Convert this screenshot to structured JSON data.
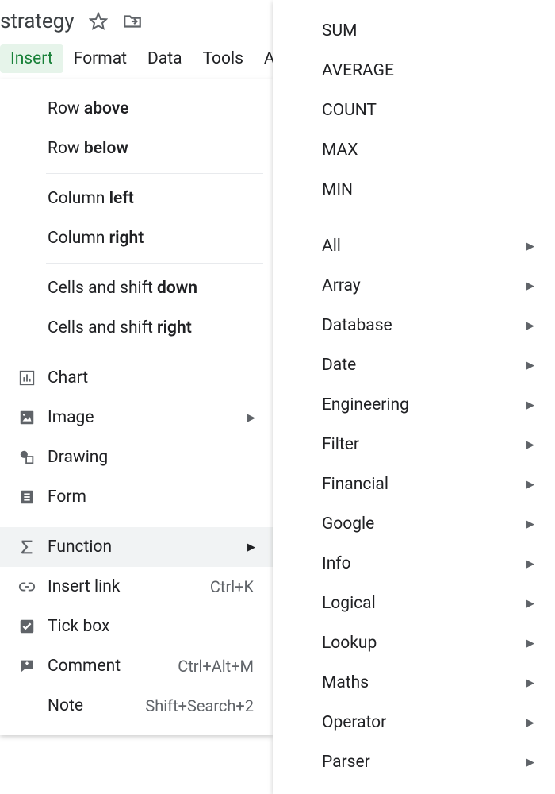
{
  "doc_title_fragment": "strategy",
  "menubar": {
    "insert": "Insert",
    "format": "Format",
    "data": "Data",
    "tools": "Tools",
    "next_letter": "A"
  },
  "insert_menu": {
    "row_above_prefix": "Row ",
    "row_above_bold": "above",
    "row_below_prefix": "Row ",
    "row_below_bold": "below",
    "col_left_prefix": "Column ",
    "col_left_bold": "left",
    "col_right_prefix": "Column ",
    "col_right_bold": "right",
    "cells_down_prefix": "Cells and shift ",
    "cells_down_bold": "down",
    "cells_right_prefix": "Cells and shift ",
    "cells_right_bold": "right",
    "chart": "Chart",
    "image": "Image",
    "drawing": "Drawing",
    "form": "Form",
    "function": "Function",
    "insert_link": "Insert link",
    "insert_link_shortcut": "Ctrl+K",
    "tick_box": "Tick box",
    "comment": "Comment",
    "comment_shortcut": "Ctrl+Alt+M",
    "note": "Note",
    "note_shortcut": "Shift+Search+2"
  },
  "function_submenu": {
    "common": [
      "SUM",
      "AVERAGE",
      "COUNT",
      "MAX",
      "MIN"
    ],
    "categories": [
      "All",
      "Array",
      "Database",
      "Date",
      "Engineering",
      "Filter",
      "Financial",
      "Google",
      "Info",
      "Logical",
      "Lookup",
      "Maths",
      "Operator",
      "Parser"
    ]
  }
}
